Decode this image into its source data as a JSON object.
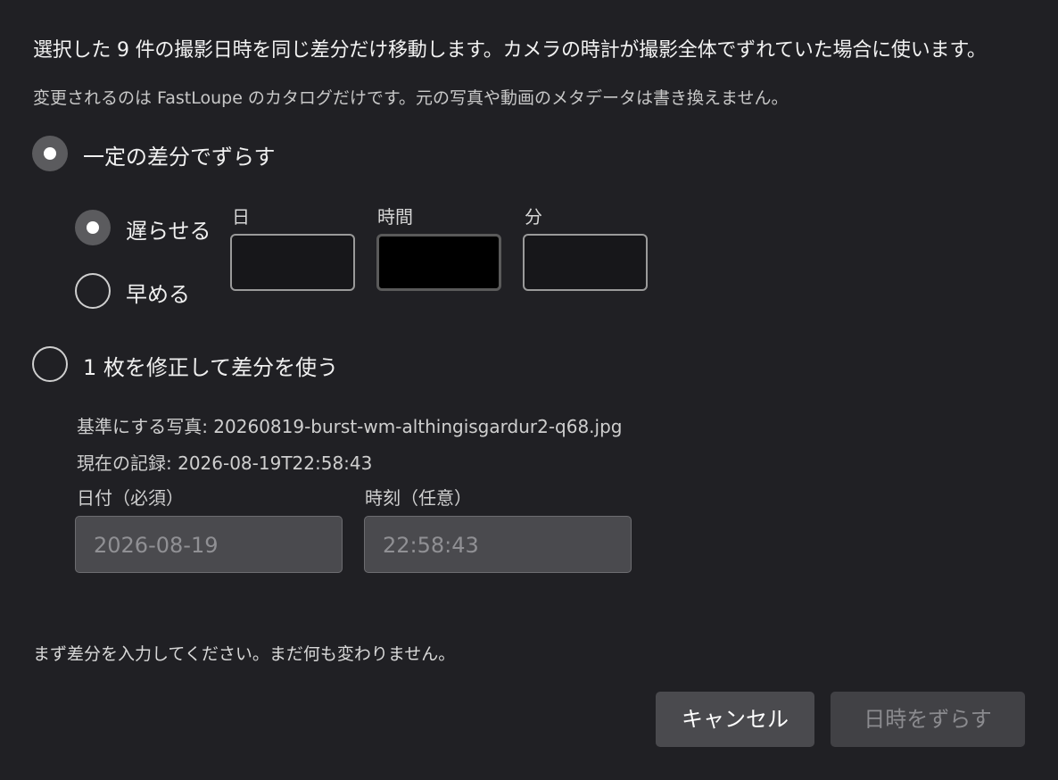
{
  "intro": "選択した 9 件の撮影日時を同じ差分だけ移動します。カメラの時計が撮影全体でずれていた場合に使います。",
  "catalog_note": "変更されるのは FastLoupe のカタログだけです。元の写真や動画のメタデータは書き換えません。",
  "mode_offset": {
    "label": "一定の差分でずらす",
    "selected": true,
    "direction": {
      "later_label": "遅らせる",
      "earlier_label": "早める",
      "selected": "later"
    },
    "fields": {
      "days_label": "日",
      "hours_label": "時間",
      "minutes_label": "分",
      "days_value": "",
      "hours_value": "",
      "minutes_value": ""
    }
  },
  "mode_reference": {
    "label": "1 枚を修正して差分を使う",
    "selected": false,
    "reference_photo": "基準にする写真: 20260819-burst-wm-althingisgardur2-q68.jpg",
    "current_record": "現在の記録: 2026-08-19T22:58:43",
    "date_label": "日付（必須）",
    "time_label": "時刻（任意）",
    "date_placeholder": "2026-08-19",
    "time_placeholder": "22:58:43"
  },
  "status_message": "まず差分を入力してください。まだ何も変わりません。",
  "buttons": {
    "cancel": "キャンセル",
    "apply": "日時をずらす"
  },
  "colors": {
    "background": "#202024",
    "field_disabled": "#4a4a4e",
    "radio_checked": "#5b5b5e"
  }
}
